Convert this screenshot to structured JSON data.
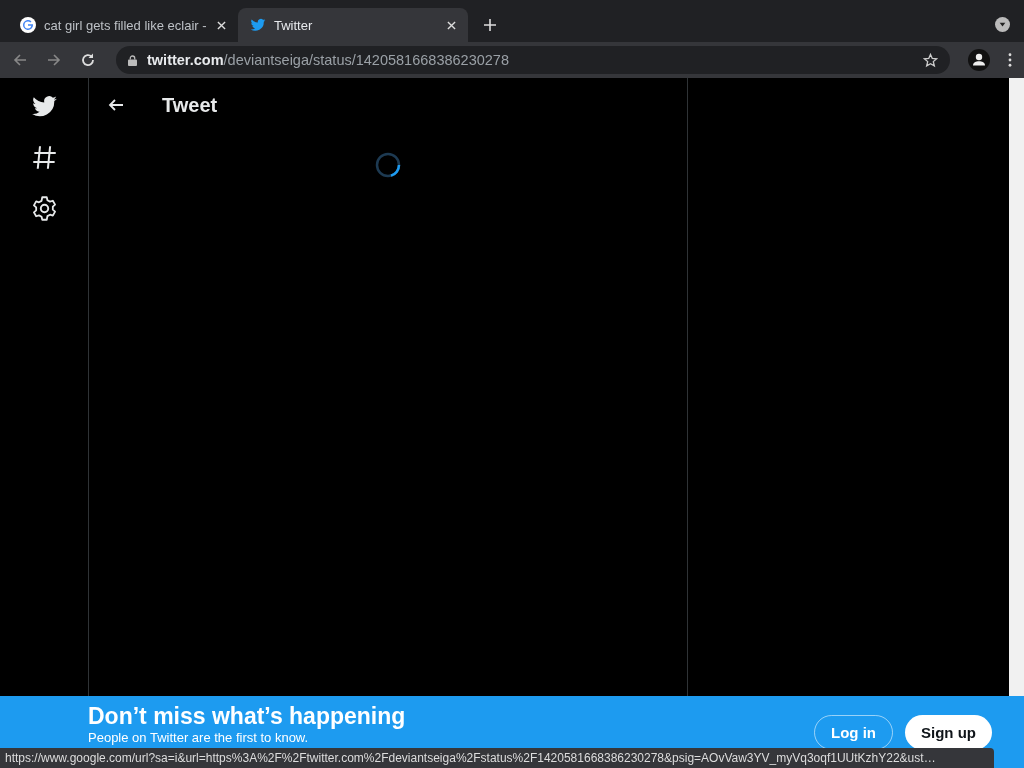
{
  "tabs": [
    {
      "title": "cat girl gets filled like eclair -",
      "kind": "google",
      "selected": false
    },
    {
      "title": "Twitter",
      "kind": "twitter",
      "selected": true
    }
  ],
  "address_bar": {
    "domain": "twitter.com",
    "path": "/deviantseiga/status/1420581668386230278"
  },
  "page": {
    "header_title": "Tweet",
    "loading": true
  },
  "banner": {
    "headline": "Don’t miss what’s happening",
    "subline": "People on Twitter are the first to know.",
    "login": "Log in",
    "signup": "Sign up"
  },
  "status_bar": "https://www.google.com/url?sa=i&url=https%3A%2F%2Ftwitter.com%2Fdeviantseiga%2Fstatus%2F1420581668386230278&psig=AOvVaw3YV_myVq3oqf1UUtKzhY22&ust…"
}
